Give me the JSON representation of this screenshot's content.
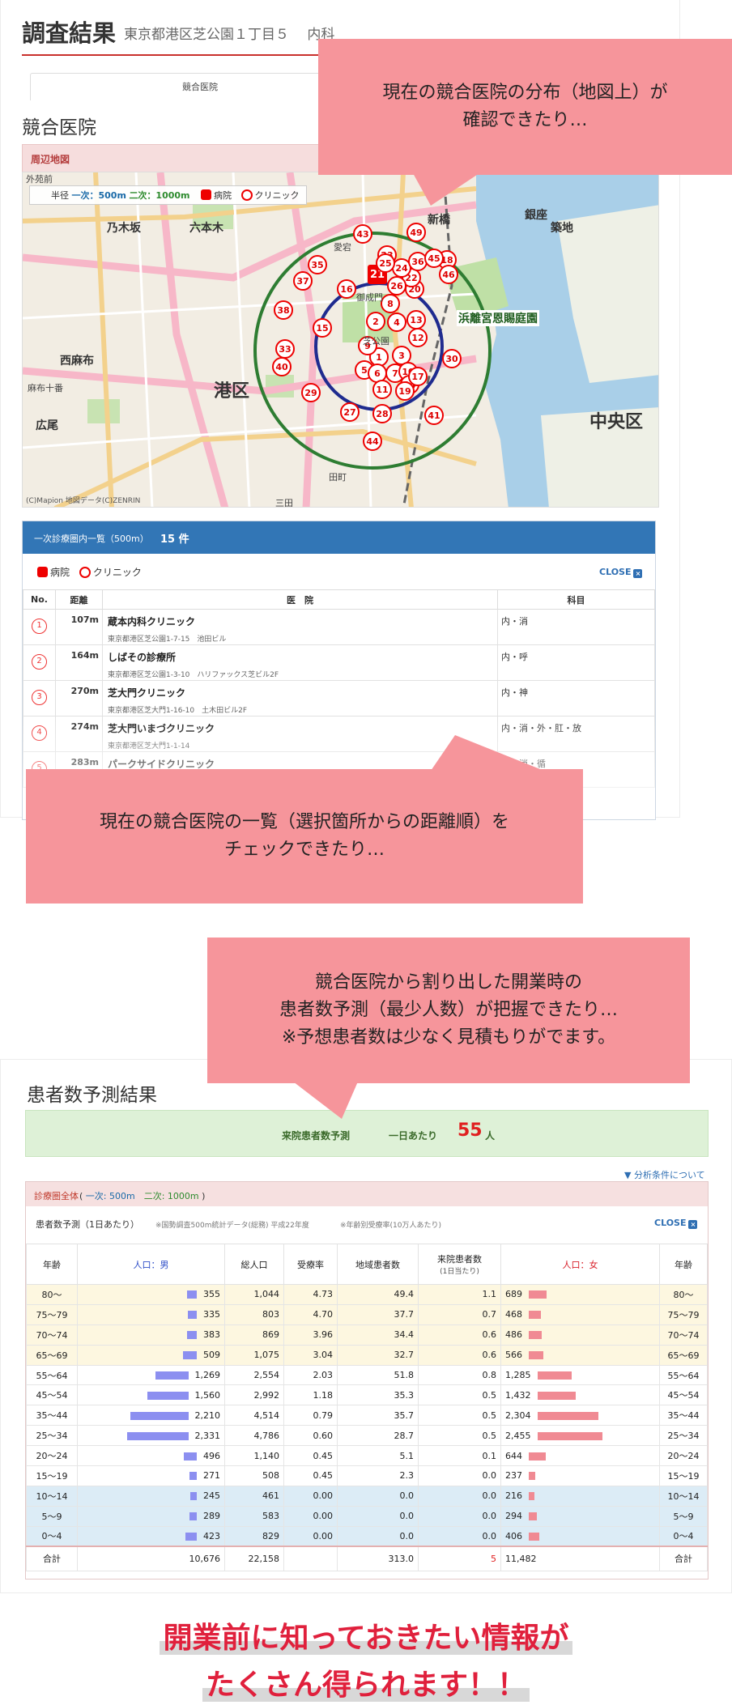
{
  "panel1": {
    "title": "調査結果",
    "subtitle": "東京都港区芝公園１丁目５　 内科",
    "tab_label": "競合医院",
    "section_title": "競合医院",
    "map_section_label": "周辺地図",
    "map": {
      "legend_prefix": "半径",
      "legend_primary": "一次：500m",
      "legend_secondary": "二次：1000m",
      "legend_hospital": "病院",
      "legend_clinic": "クリニック",
      "labels": [
        "外苑前",
        "乃木坂",
        "六本木",
        "西麻布",
        "広尾",
        "麻布十番",
        "港区",
        "三田",
        "中央区",
        "築地",
        "新橋",
        "銀座",
        "愛宕",
        "御成門",
        "浜離宮恩賜庭園",
        "芝公園",
        "田町"
      ],
      "big_label": "港区",
      "big_label_2": "中央区",
      "garden_label": "浜離宮恩賜庭園",
      "copyright": "(C)Mapion 地図データ(C)ZENRIN",
      "markers": [
        "1",
        "2",
        "3",
        "4",
        "5",
        "6",
        "7",
        "8",
        "9",
        "10",
        "11",
        "12",
        "13",
        "14",
        "15",
        "16",
        "17",
        "18",
        "19",
        "20",
        "21",
        "22",
        "23",
        "24",
        "25",
        "26",
        "27",
        "28",
        "29",
        "30",
        "33",
        "35",
        "36",
        "37",
        "38",
        "40",
        "41",
        "43",
        "44",
        "45",
        "46",
        "49"
      ]
    },
    "list": {
      "title": "一次診療圏内一覧（500m）",
      "count": "15 件",
      "legend_hospital": "病院",
      "legend_clinic": "クリニック",
      "close": "CLOSE",
      "headers": [
        "No.",
        "距離",
        "医　院",
        "科目"
      ],
      "rows": [
        {
          "no": "1",
          "dist": "107m",
          "name": "蔵本内科クリニック",
          "addr": "東京都港区芝公園1-7-15　池田ビル",
          "dept": "内・消"
        },
        {
          "no": "2",
          "dist": "164m",
          "name": "しばその診療所",
          "addr": "東京都港区芝公園1-3-10　ハリファックス芝ビル2F",
          "dept": "内・呼"
        },
        {
          "no": "3",
          "dist": "270m",
          "name": "芝大門クリニック",
          "addr": "東京都港区芝大門1-16-10　土木田ビル2F",
          "dept": "内・神"
        },
        {
          "no": "4",
          "dist": "274m",
          "name": "芝大門いまづクリニック",
          "addr": "東京都港区芝大門1-1-14",
          "dept": "内・消・外・肛・放"
        },
        {
          "no": "5",
          "dist": "283m",
          "name": "パークサイドクリニック",
          "addr": "",
          "dept": "内・消・循"
        }
      ]
    }
  },
  "callouts": {
    "c1": [
      "現在の競合医院の分布（地図上）が",
      "確認できたり…"
    ],
    "c2": [
      "現在の競合医院の一覧（選択箇所からの距離順）を",
      "チェックできたり…"
    ],
    "c3": [
      "競合医院から割り出した開業時の",
      "患者数予測（最少人数）が把握できたり…",
      "※予想患者数は少なく見積もりがでます。"
    ]
  },
  "panel2": {
    "title": "患者数予測結果",
    "summary_label": "来院患者数予測",
    "summary_per": "一日あたり",
    "summary_value": "55",
    "summary_unit": "人",
    "analysis_link": "分析条件について",
    "range_label": "診療圏全体",
    "range_primary": "一次: 500m",
    "range_secondary": "二次: 1000m",
    "est_label": "患者数予測（1日あたり）",
    "note1": "※国勢調査500m統計データ(総務) 平成22年度",
    "note2": "※年齢別受療率(10万人あたり)",
    "close": "CLOSE",
    "headers": {
      "age": "年齢",
      "male": "人口：男",
      "total": "総人口",
      "rate": "受療率",
      "local": "地域患者数",
      "visit": "来院患者数",
      "visit_sub": "(1日当たり)",
      "female": "人口：女",
      "age2": "年齢"
    },
    "rows": [
      {
        "age": "80～",
        "male": "355",
        "total": "1,044",
        "rate": "4.73",
        "local": "49.4",
        "visit": "1.1",
        "female": "689",
        "band": "y",
        "mv": 355,
        "fv": 689
      },
      {
        "age": "75～79",
        "male": "335",
        "total": "803",
        "rate": "4.70",
        "local": "37.7",
        "visit": "0.7",
        "female": "468",
        "band": "y",
        "mv": 335,
        "fv": 468
      },
      {
        "age": "70～74",
        "male": "383",
        "total": "869",
        "rate": "3.96",
        "local": "34.4",
        "visit": "0.6",
        "female": "486",
        "band": "y",
        "mv": 383,
        "fv": 486
      },
      {
        "age": "65～69",
        "male": "509",
        "total": "1,075",
        "rate": "3.04",
        "local": "32.7",
        "visit": "0.6",
        "female": "566",
        "band": "y",
        "mv": 509,
        "fv": 566
      },
      {
        "age": "55～64",
        "male": "1,269",
        "total": "2,554",
        "rate": "2.03",
        "local": "51.8",
        "visit": "0.8",
        "female": "1,285",
        "band": "w",
        "mv": 1269,
        "fv": 1285
      },
      {
        "age": "45～54",
        "male": "1,560",
        "total": "2,992",
        "rate": "1.18",
        "local": "35.3",
        "visit": "0.5",
        "female": "1,432",
        "band": "w",
        "mv": 1560,
        "fv": 1432
      },
      {
        "age": "35～44",
        "male": "2,210",
        "total": "4,514",
        "rate": "0.79",
        "local": "35.7",
        "visit": "0.5",
        "female": "2,304",
        "band": "w",
        "mv": 2210,
        "fv": 2304
      },
      {
        "age": "25～34",
        "male": "2,331",
        "total": "4,786",
        "rate": "0.60",
        "local": "28.7",
        "visit": "0.5",
        "female": "2,455",
        "band": "w",
        "mv": 2331,
        "fv": 2455
      },
      {
        "age": "20～24",
        "male": "496",
        "total": "1,140",
        "rate": "0.45",
        "local": "5.1",
        "visit": "0.1",
        "female": "644",
        "band": "w",
        "mv": 496,
        "fv": 644
      },
      {
        "age": "15～19",
        "male": "271",
        "total": "508",
        "rate": "0.45",
        "local": "2.3",
        "visit": "0.0",
        "female": "237",
        "band": "w",
        "mv": 271,
        "fv": 237
      },
      {
        "age": "10～14",
        "male": "245",
        "total": "461",
        "rate": "0.00",
        "local": "0.0",
        "visit": "0.0",
        "female": "216",
        "band": "b",
        "mv": 245,
        "fv": 216
      },
      {
        "age": "5～9",
        "male": "289",
        "total": "583",
        "rate": "0.00",
        "local": "0.0",
        "visit": "0.0",
        "female": "294",
        "band": "b",
        "mv": 289,
        "fv": 294
      },
      {
        "age": "0～4",
        "male": "423",
        "total": "829",
        "rate": "0.00",
        "local": "0.0",
        "visit": "0.0",
        "female": "406",
        "band": "b",
        "mv": 423,
        "fv": 406
      }
    ],
    "total_row": {
      "age": "合計",
      "male": "10,676",
      "total": "22,158",
      "rate": "",
      "local": "313.0",
      "visit": "5",
      "female": "11,482",
      "age2": "合計"
    }
  },
  "footer": {
    "line1": "開業前に知っておきたい情報が",
    "line2": "たくさん得られます！！"
  },
  "colors": {
    "accent_red": "#e0203c",
    "callout_pink": "#f6959b",
    "list_header_blue": "#3276b6",
    "male_bar": "#8c8ff0",
    "female_bar": "#f08a93"
  }
}
